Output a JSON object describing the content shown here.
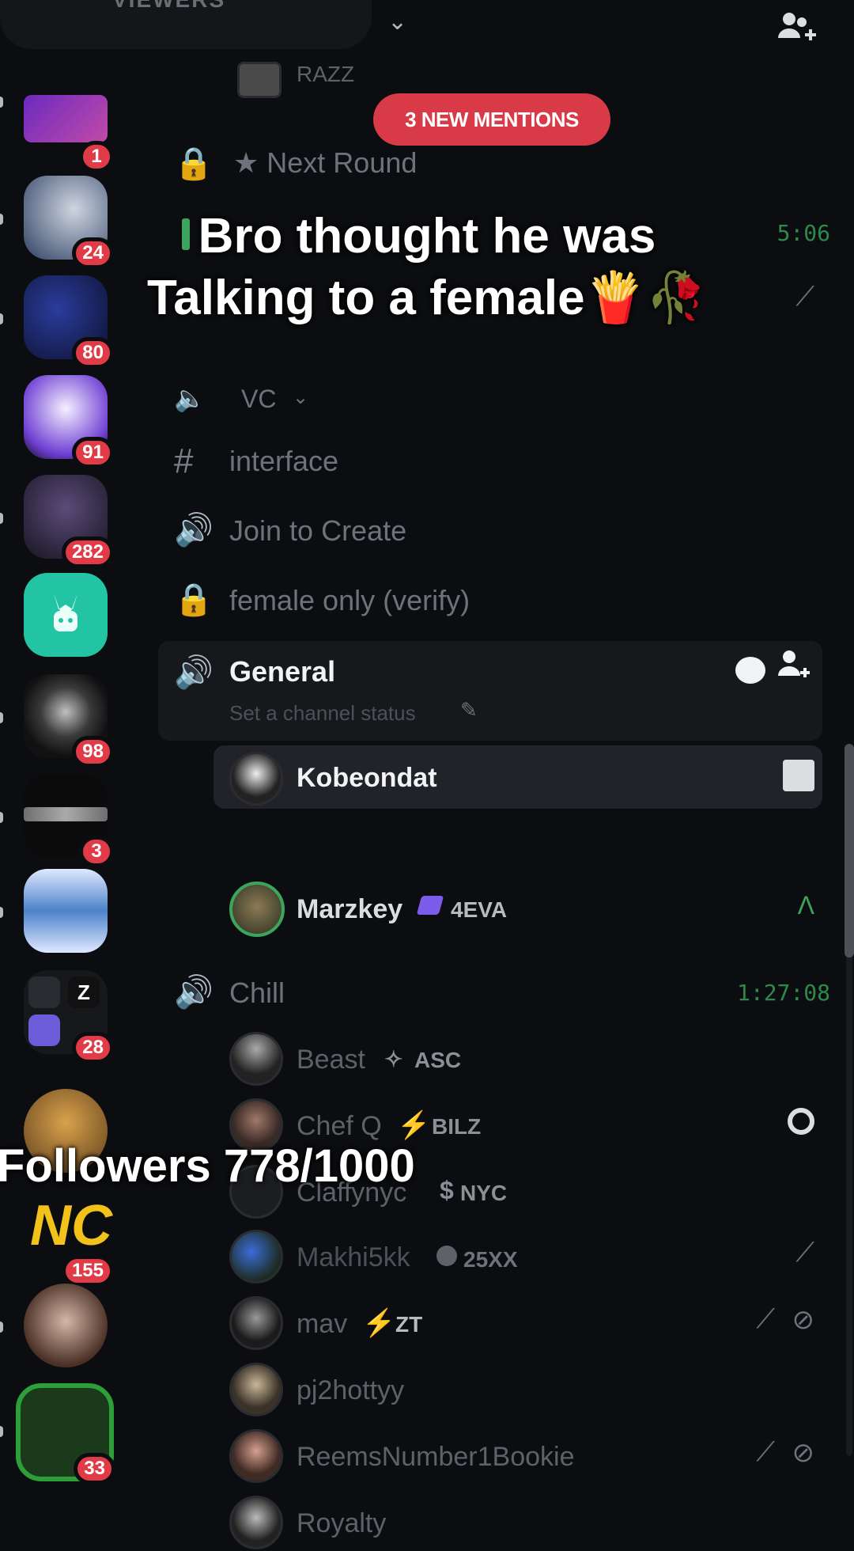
{
  "topbar": {
    "viewers_label": "VIEWERS"
  },
  "mentions": {
    "label": "3 NEW MENTIONS"
  },
  "caption": {
    "line1": "Bro thought he was",
    "line2": "Talking to a female🍟🥀"
  },
  "followers": {
    "text": "Followers 778/1000"
  },
  "servers": [
    {
      "badge": "1"
    },
    {
      "badge": "24"
    },
    {
      "badge": "80"
    },
    {
      "badge": "91"
    },
    {
      "badge": "282"
    },
    {
      "badge": ""
    },
    {
      "badge": "98"
    },
    {
      "badge": "3"
    },
    {
      "badge": ""
    },
    {
      "badge": "28"
    },
    {
      "badge": ""
    },
    {
      "badge": "155"
    },
    {
      "badge": ""
    },
    {
      "badge": "33"
    }
  ],
  "channels": {
    "partial_top": "RAZZ",
    "next_round": "★ Next Round",
    "timer_top": "5:06",
    "vc_category": "VC",
    "interface": "interface",
    "join_to_create": "Join to Create",
    "female_only": "female only (verify)",
    "general": "General",
    "general_status": "Set a channel status",
    "chill": "Chill",
    "chill_timer": "1:27:08"
  },
  "general_users": [
    {
      "name": "Kobeondat",
      "tag": ""
    },
    {
      "name": "Marzkey",
      "tag": "4EVA"
    }
  ],
  "chill_users": [
    {
      "name": "Beast",
      "tag": "ASC"
    },
    {
      "name": "Chef Q",
      "tag": "BILZ"
    },
    {
      "name": "Claffynyc",
      "tag": "NYC"
    },
    {
      "name": "Makhi5kk",
      "tag": "25XX"
    },
    {
      "name": "mav",
      "tag": "ZT"
    },
    {
      "name": "pj2hottyy",
      "tag": ""
    },
    {
      "name": "ReemsNumber1Bookie",
      "tag": ""
    },
    {
      "name": "Royalty",
      "tag": ""
    }
  ],
  "colors": {
    "background": "#0c0d10",
    "badge_red": "#e23b48",
    "voice_green": "#3ba55d",
    "mention_pill": "#d83a48"
  }
}
